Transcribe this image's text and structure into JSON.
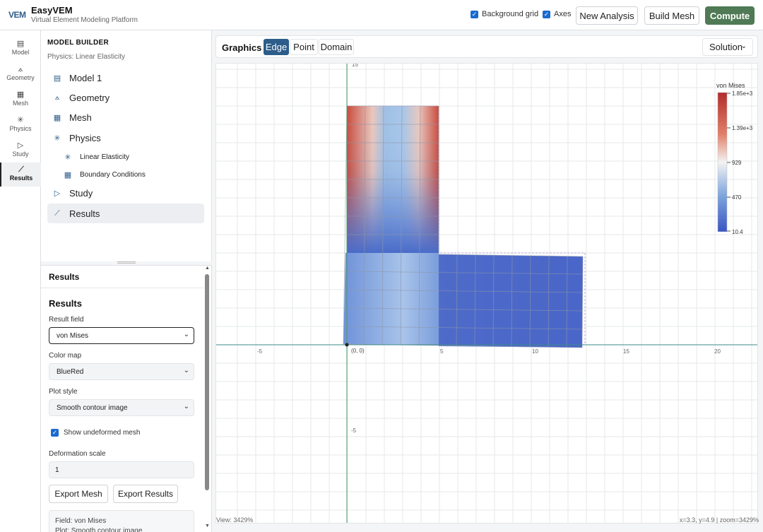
{
  "app": {
    "logo": "VEM",
    "title": "EasyVEM",
    "subtitle": "Virtual Element Modeling Platform"
  },
  "toolbar": {
    "background_grid_label": "Background grid",
    "background_grid_checked": true,
    "axes_label": "Axes",
    "axes_checked": true,
    "new_analysis_label": "New Analysis",
    "build_mesh_label": "Build Mesh",
    "compute_label": "Compute"
  },
  "rail": {
    "items": [
      {
        "label": "Model",
        "icon": "document-icon"
      },
      {
        "label": "Geometry",
        "icon": "geometry-icon"
      },
      {
        "label": "Mesh",
        "icon": "mesh-icon"
      },
      {
        "label": "Physics",
        "icon": "physics-icon"
      },
      {
        "label": "Study",
        "icon": "play-icon"
      },
      {
        "label": "Results",
        "icon": "chart-icon",
        "active": true
      }
    ]
  },
  "builder": {
    "title": "MODEL BUILDER",
    "physics": "Physics: Linear Elasticity",
    "tree": [
      {
        "label": "Model 1",
        "icon": "document-icon"
      },
      {
        "label": "Geometry",
        "icon": "geometry-icon"
      },
      {
        "label": "Mesh",
        "icon": "mesh-icon"
      },
      {
        "label": "Physics",
        "icon": "physics-icon"
      },
      {
        "label": "Linear Elasticity",
        "icon": "physics-icon",
        "sub": true
      },
      {
        "label": "Boundary Conditions",
        "icon": "mesh-icon",
        "sub": true
      },
      {
        "label": "Study",
        "icon": "play-icon"
      },
      {
        "label": "Results",
        "icon": "chart-icon",
        "active": true
      }
    ]
  },
  "results": {
    "header": "Results",
    "section_title": "Results",
    "result_field_label": "Result field",
    "result_field_value": "von Mises",
    "color_map_label": "Color map",
    "color_map_value": "BlueRed",
    "plot_style_label": "Plot style",
    "plot_style_value": "Smooth contour image",
    "show_undeformed_label": "Show undeformed mesh",
    "show_undeformed_checked": true,
    "deformation_scale_label": "Deformation scale",
    "deformation_scale_value": "1",
    "export_mesh_label": "Export Mesh",
    "export_results_label": "Export Results",
    "info_line1": "Field: von Mises",
    "info_line2": "Plot: Smooth contour image"
  },
  "graphics": {
    "title": "Graphics",
    "modes": [
      "Edge",
      "Point",
      "Domain"
    ],
    "active_mode": "Edge",
    "view_select": "Solution",
    "origin_label": "(0, 0)",
    "x_ticks": [
      "-5",
      "5",
      "10",
      "15",
      "20"
    ],
    "y_ticks": [
      "15",
      "-5"
    ],
    "legend": {
      "title": "von Mises",
      "max": "1.85e+3",
      "values": [
        "1.85e+3",
        "1.39e+3",
        "929",
        "470",
        "10.4"
      ]
    },
    "view_status": "View: 3429%",
    "cursor_status": "x=3.3, y=4.9 | zoom=3429%"
  },
  "colors": {
    "accent": "#2d5d8a",
    "compute": "#4f7a55",
    "blue_low": "#3b55c4",
    "red_high": "#c0392b"
  }
}
